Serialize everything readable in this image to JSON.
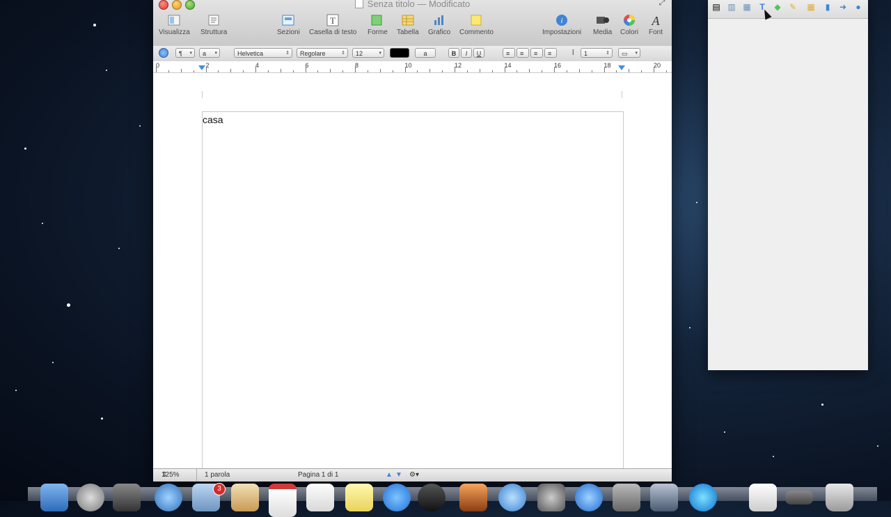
{
  "window": {
    "title": "Senza titolo",
    "modified": "— Modificato"
  },
  "toolbar": {
    "visualizza": "Visualizza",
    "struttura": "Struttura",
    "sezioni": "Sezioni",
    "casella_di_testo": "Casella di testo",
    "forme": "Forme",
    "tabella": "Tabella",
    "grafico": "Grafico",
    "commento": "Commento",
    "impostazioni": "Impostazioni",
    "media": "Media",
    "colori": "Colori",
    "font": "Font"
  },
  "format_bar": {
    "paragraph_style": "¶",
    "char_style": "a",
    "font_family": "Helvetica",
    "font_style": "Regolare",
    "font_size": "12",
    "text_color": "#000000",
    "highlight": "a",
    "bold": "B",
    "italic": "I",
    "underline": "U",
    "line_spacing": "1"
  },
  "ruler": {
    "numbers": [
      "0",
      "2",
      "4",
      "6",
      "8",
      "10",
      "12",
      "14",
      "16",
      "18",
      "20"
    ]
  },
  "document": {
    "text": "casa"
  },
  "status": {
    "zoom": "125%",
    "word_count": "1 parola",
    "page": "Pagina 1 di 1"
  },
  "dock": {
    "badge_count": "3"
  }
}
